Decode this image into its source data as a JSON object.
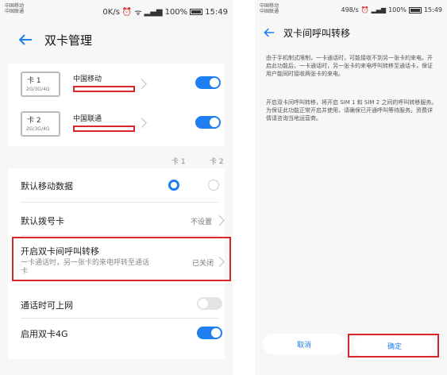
{
  "left": {
    "status": {
      "carrier1": "中国移动",
      "carrier2": "中国联通",
      "speed": "0K/s",
      "signal": "ᯤ⁴ᴳ.ıl ⁴ᴳ.ıl",
      "battery": "100%",
      "time": "15:49"
    },
    "title": "双卡管理",
    "sim1": {
      "badge": "卡 1",
      "gen": "2G/3G/4G",
      "carrier": "中国移动"
    },
    "sim2": {
      "badge": "卡 2",
      "gen": "2G/3G/4G",
      "carrier": "中国联通"
    },
    "col1": "卡 1",
    "col2": "卡 2",
    "default_data": "默认移动数据",
    "default_dial": "默认拨号卡",
    "default_dial_value": "不设置",
    "forward_title": "开启双卡间呼叫转移",
    "forward_sub": "一卡通话时，另一张卡的来电呼转至通话卡",
    "forward_value": "已关闭",
    "internet_call": "通话时可上网",
    "enable_4g": "启用双卡4G",
    "accent": "#1f7ef0",
    "highlight": "#d9262a"
  },
  "right": {
    "status": {
      "carrier1": "中国移动",
      "carrier2": "中国联通",
      "speed": "498/s",
      "signal": "ᯤ⁴ᴳ.ıl ⁴ᴳ.ıl",
      "battery": "100%",
      "time": "15:49"
    },
    "title": "双卡间呼叫转移",
    "para1": "由于手机制式限制，一卡通话时，可能接收不到另一张卡的来电。开启此功能后，一卡通话时，另一张卡的来电呼叫转移至通话卡，保证用户能同时接收两张卡的来电。",
    "para2": "开启双卡间呼叫转移，将开启 SIM 1 和 SIM 2 之间的呼叫转移服务。为保证此功能正常开启并使用，请确保已开通呼叫等待服务。资费详情请咨询当地运营商。",
    "cancel": "取消",
    "ok": "确定"
  }
}
